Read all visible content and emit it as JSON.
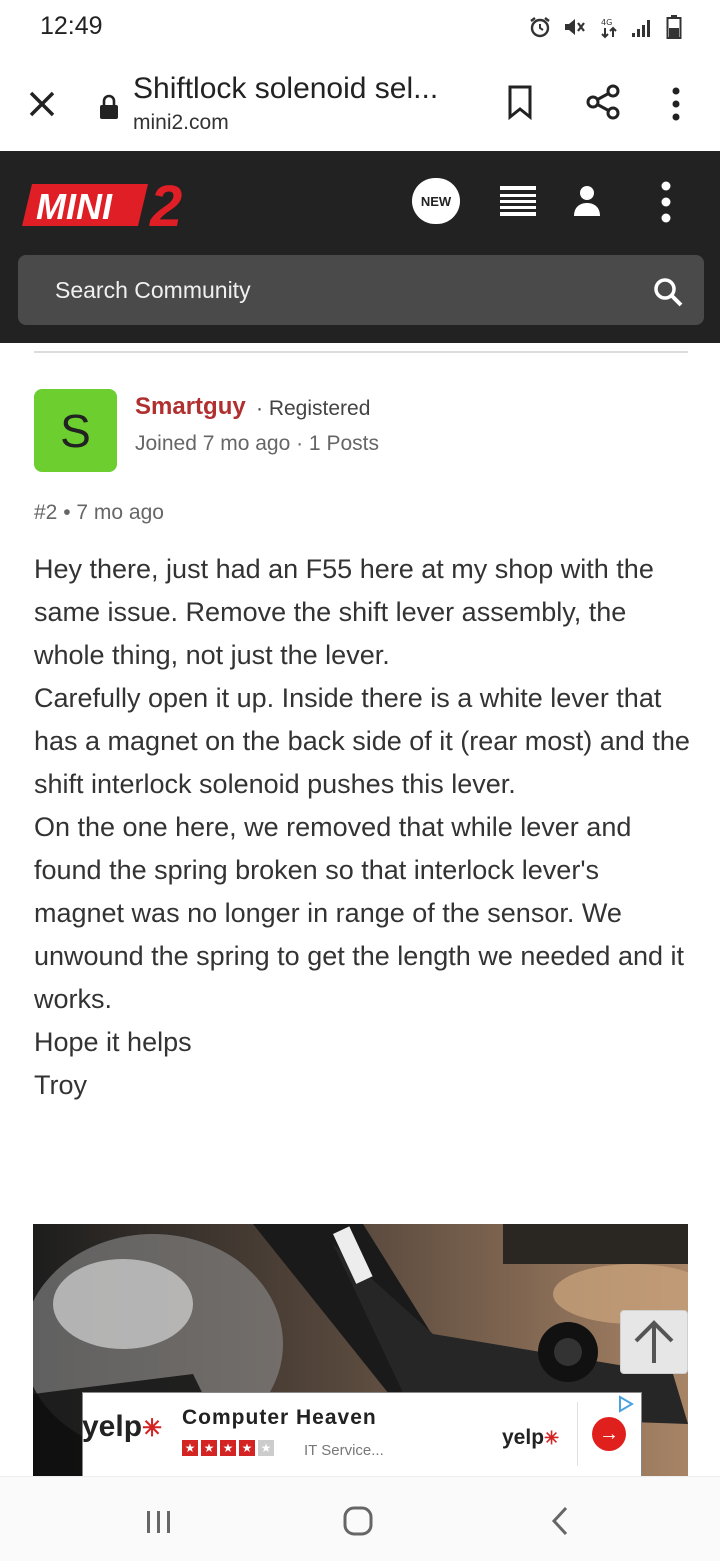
{
  "status_bar": {
    "time": "12:49"
  },
  "browser": {
    "title": "Shiftlock solenoid sel...",
    "url": "mini2.com"
  },
  "site": {
    "logo_text": "MINI",
    "logo_num": "2",
    "new_label": "NEW",
    "search_placeholder": "Search Community"
  },
  "post": {
    "avatar_letter": "S",
    "username": "Smartguy",
    "role": "· Registered",
    "joined": "Joined 7 mo ago · 1 Posts",
    "post_meta": "#2 • 7 mo ago",
    "paragraphs": [
      "Hey there, just had an F55 here at my shop with the same issue. Remove the shift lever assembly, the whole thing, not just the lever.",
      "Carefully open it up. Inside there is a white lever that has a magnet on the back side of it (rear most) and the shift interlock solenoid pushes this lever.",
      "On the one here, we removed that while lever and found the spring broken so that interlock lever's magnet was no longer in range of the sensor. We unwound the spring to get the length we needed and it works.",
      "Hope it helps",
      "Troy"
    ]
  },
  "ad": {
    "brand_left": "yelp",
    "name": "Computer Heaven",
    "rating": 4,
    "category": "IT Service...",
    "brand_right": "yelp"
  },
  "colors": {
    "header_bg": "#222222",
    "logo_red": "#e01e26",
    "username": "#b03030",
    "avatar_bg": "#6ccf2f"
  }
}
